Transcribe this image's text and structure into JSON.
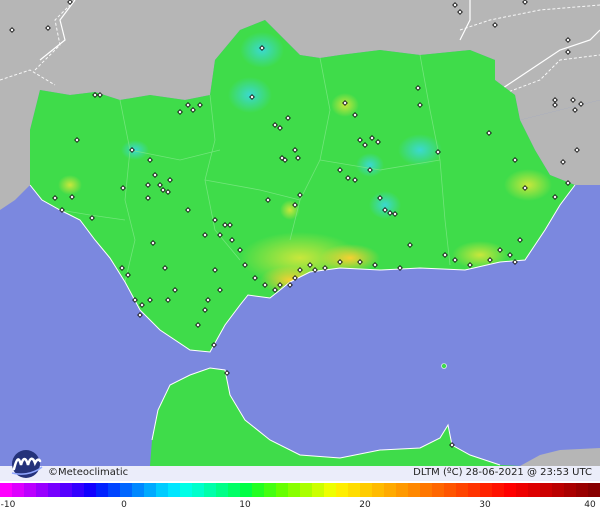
{
  "brand": {
    "name": "Meteoclimatic",
    "symbol": "©"
  },
  "caption": {
    "variable": "DLTM (ºC)",
    "date": "28-06-2021",
    "separator": "@",
    "time": "23:53 UTC"
  },
  "scale": {
    "ticks": [
      "-10",
      "0",
      "10",
      "20",
      "30",
      "40"
    ],
    "min": -10,
    "max": 40,
    "colors": [
      "#ff00ff",
      "#dd00ff",
      "#bb00ff",
      "#9900ff",
      "#7700ff",
      "#5500ff",
      "#3300ff",
      "#1100ff",
      "#0022ff",
      "#0044ff",
      "#0066ff",
      "#0088ff",
      "#00aaff",
      "#00ccff",
      "#00e6ff",
      "#00ffe6",
      "#00ffcc",
      "#00ffaa",
      "#00ff88",
      "#00ff66",
      "#00ff44",
      "#22ff22",
      "#44ff11",
      "#66ff00",
      "#88ff00",
      "#aaff00",
      "#ccff00",
      "#eeff00",
      "#ffee00",
      "#ffdd00",
      "#ffcc00",
      "#ffbb00",
      "#ffaa00",
      "#ff9900",
      "#ff8800",
      "#ff7700",
      "#ff6600",
      "#ff5500",
      "#ff4400",
      "#ff3300",
      "#ff2200",
      "#ff1100",
      "#ff0000",
      "#ee0000",
      "#dd0000",
      "#cc0000",
      "#bb0000",
      "#aa0000",
      "#990000",
      "#880000"
    ]
  },
  "colors": {
    "sea": "#7b88df",
    "land_outside": "#b6b6b6",
    "region": "#3fdc4a",
    "coast": "#ffffff"
  }
}
